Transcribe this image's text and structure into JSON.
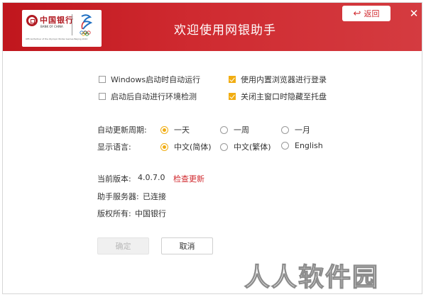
{
  "header": {
    "title": "欢迎使用网银助手",
    "logo": {
      "bank_cn": "中国银行",
      "bank_en": "BANK OF CHINA",
      "small_text": "Official Partner of the Olympic Winter Games Beijing 2022"
    },
    "back_label": "返回",
    "close_symbol": "✕",
    "colors": {
      "header_bg": "#c8161d",
      "accent": "#d12a2f",
      "check": "#f1ad12"
    }
  },
  "options": {
    "startup_autorun": {
      "label": "Windows启动时自动运行",
      "checked": false
    },
    "builtin_browser": {
      "label": "使用内置浏览器进行登录",
      "checked": true
    },
    "env_check": {
      "label": "启动后自动进行环境检测",
      "checked": false
    },
    "hide_to_tray": {
      "label": "关闭主窗口时隐藏至托盘",
      "checked": true
    }
  },
  "update": {
    "label": "自动更新周期:",
    "choices": [
      {
        "label": "一天",
        "selected": true
      },
      {
        "label": "一周",
        "selected": false
      },
      {
        "label": "一月",
        "selected": false
      }
    ]
  },
  "language": {
    "label": "显示语言:",
    "choices": [
      {
        "label": "中文(简体)",
        "selected": true
      },
      {
        "label": "中文(繁体)",
        "selected": false
      },
      {
        "label": "English",
        "selected": false
      }
    ]
  },
  "info": {
    "version_label": "当前版本:",
    "version_value": "4.0.7.0",
    "check_update": "检查更新",
    "server_label": "助手服务器:",
    "server_value": "已连接",
    "copyright_label": "版权所有:",
    "copyright_value": "中国银行"
  },
  "buttons": {
    "ok": "确定",
    "cancel": "取消"
  },
  "watermark": "人人软件园"
}
